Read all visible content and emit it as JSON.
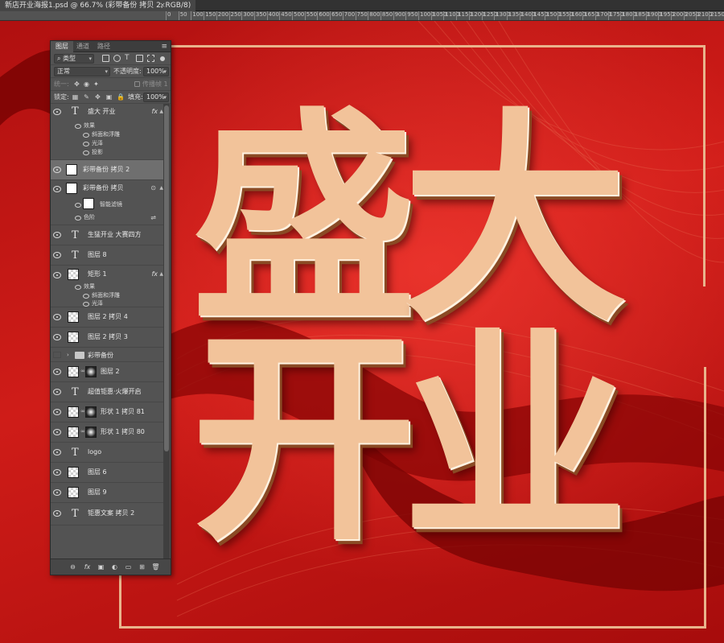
{
  "document": {
    "tab_title": "新店开业海报1.psd @ 66.7% (彩带备份 拷贝 2, RGB/8)",
    "close": "×"
  },
  "ruler": {
    "ticks": [
      "0",
      "50",
      "100",
      "150",
      "200",
      "250",
      "300",
      "350",
      "400",
      "450",
      "500",
      "550",
      "600",
      "650",
      "700",
      "750",
      "800",
      "850",
      "900",
      "950",
      "1000",
      "1050",
      "1100",
      "1150",
      "1200",
      "1250",
      "1300",
      "1350",
      "1400",
      "1450",
      "1500",
      "1550",
      "1600",
      "1650",
      "1700",
      "1750",
      "1800",
      "1850",
      "1900",
      "1950",
      "2000",
      "2050",
      "2100",
      "2150"
    ]
  },
  "poster": {
    "chars": [
      "盛",
      "大",
      "开",
      "业"
    ],
    "accent_color": "#f2c39a",
    "background_color": "#c3150f"
  },
  "layers_panel": {
    "tabs": [
      "图层",
      "通道",
      "路径"
    ],
    "menu_icon": "≡",
    "filter_kind": "类型",
    "blend_mode": "正常",
    "opacity_label": "不透明度:",
    "opacity_value": "100%",
    "unify_label": "统一:",
    "propagate_label": "传播帧 1",
    "lock_label": "锁定:",
    "fill_label": "填充:",
    "fill_value": "100%",
    "layers": [
      {
        "type": "text",
        "name": "盛大 开业",
        "fx": "fx",
        "effects_label": "效果",
        "effects": [
          "斜面和浮雕",
          "光泽",
          "投影"
        ]
      },
      {
        "type": "smart",
        "name": "彩带备份 拷贝 2",
        "selected": true
      },
      {
        "type": "smart",
        "name": "彩带备份 拷贝",
        "filter_label": "智能滤镜",
        "filter": "色阶"
      },
      {
        "type": "text",
        "name": "生猛开业 大赛四方"
      },
      {
        "type": "text",
        "name": "图层 8"
      },
      {
        "type": "shape",
        "name": "矩形 1",
        "fx": "fx",
        "effects_label": "效果",
        "effects": [
          "斜面和浮雕",
          "光泽"
        ]
      },
      {
        "type": "raster",
        "name": "图层 2 拷贝 4"
      },
      {
        "type": "raster",
        "name": "图层 2 拷贝 3"
      },
      {
        "type": "group",
        "name": "彩带备份"
      },
      {
        "type": "masked",
        "name": "图层 2"
      },
      {
        "type": "text",
        "name": "超值钜惠·火爆开启"
      },
      {
        "type": "masked",
        "name": "形状 1 拷贝 81"
      },
      {
        "type": "masked",
        "name": "形状 1 拷贝 80"
      },
      {
        "type": "text",
        "name": "logo"
      },
      {
        "type": "raster",
        "name": "图层 6"
      },
      {
        "type": "raster",
        "name": "图层 9"
      },
      {
        "type": "text",
        "name": "钜惠文案 拷贝 2"
      }
    ],
    "footer_icons": [
      "link-icon",
      "fx-icon",
      "mask-icon",
      "adjustment-icon",
      "folder-icon",
      "new-layer-icon",
      "trash-icon"
    ],
    "footer_glyphs": [
      "⊖",
      "fx",
      "▣",
      "◐",
      "▭",
      "⊞",
      "🗑"
    ]
  }
}
